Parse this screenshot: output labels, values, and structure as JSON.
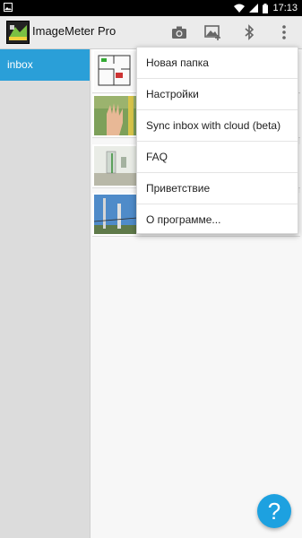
{
  "status_bar": {
    "time": "17:13"
  },
  "app_bar": {
    "title": "ImageMeter Pro"
  },
  "sidebar": {
    "items": [
      {
        "label": "inbox"
      }
    ]
  },
  "overflow_menu": {
    "items": [
      {
        "label": "Новая папка"
      },
      {
        "label": "Настройки"
      },
      {
        "label": "Sync inbox with cloud (beta)"
      },
      {
        "label": "FAQ"
      },
      {
        "label": "Приветствие"
      },
      {
        "label": "О программе..."
      }
    ]
  },
  "help_button": {
    "label": "?"
  },
  "colors": {
    "accent": "#2a9fd8",
    "fab": "#1da1e0"
  }
}
